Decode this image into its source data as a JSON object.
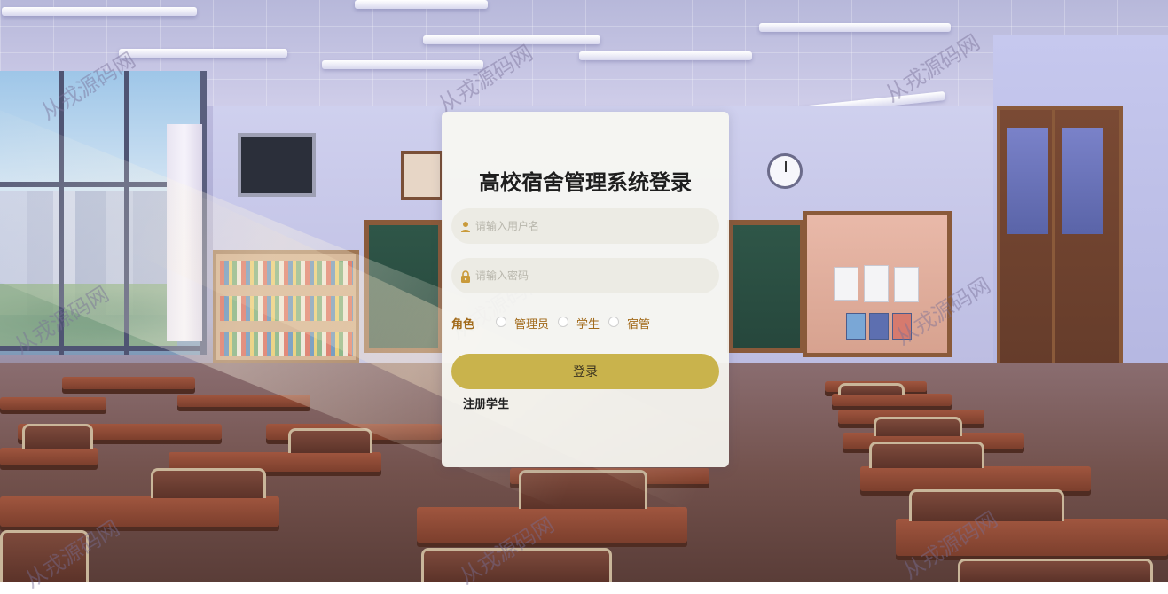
{
  "login": {
    "title": "高校宿舍管理系统登录",
    "username_placeholder": "请输入用户名",
    "password_placeholder": "请输入密码",
    "role_label": "角色",
    "roles": [
      "管理员",
      "学生",
      "宿管"
    ],
    "selected_role": null,
    "login_button": "登录",
    "register_link": "注册学生"
  },
  "watermark": {
    "text": "从戎源码网"
  },
  "colors": {
    "primary_button": "#c9b34c",
    "role_text": "#a26a1a",
    "card_bg": "#f8f7f2",
    "input_bg": "#ecebe4"
  },
  "icons": {
    "username": "user-icon",
    "password": "lock-icon"
  }
}
